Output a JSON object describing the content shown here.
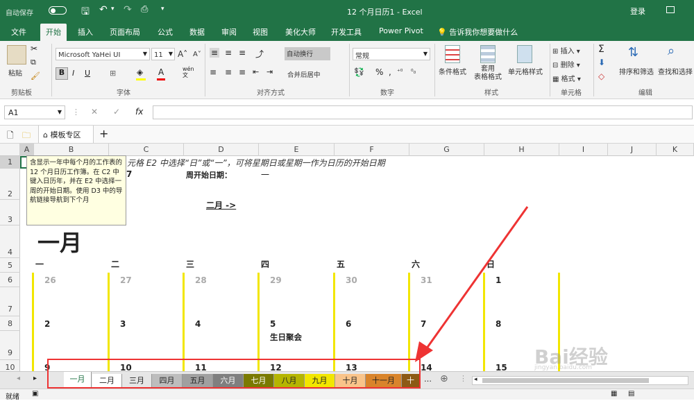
{
  "titlebar": {
    "autosave": "自动保存",
    "filename": "12 个月日历1",
    "app": "Excel",
    "login": "登录"
  },
  "tabs": [
    "文件",
    "开始",
    "插入",
    "页面布局",
    "公式",
    "数据",
    "审阅",
    "视图",
    "美化大师",
    "开发工具",
    "Power Pivot"
  ],
  "tellme": "告诉我你想要做什么",
  "ribbon": {
    "paste": "粘贴",
    "clipboard": "剪贴板",
    "font_name": "Microsoft YaHei UI",
    "font_size": "11",
    "font_group": "字体",
    "wrap": "自动换行",
    "merge": "合并后居中",
    "align_group": "对齐方式",
    "number_format": "常规",
    "number_group": "数字",
    "cond_format": "条件格式",
    "table_format": "套用\n表格格式",
    "cell_style": "单元格样式",
    "style_group": "样式",
    "insert": "插入",
    "delete": "删除",
    "format": "格式",
    "cells_group": "单元格",
    "sort_filter": "排序和筛选",
    "find_select": "查找和选择",
    "edit_group": "编辑",
    "bold": "B",
    "italic": "I",
    "underline": "U",
    "wen": "wén\n文",
    "sigma": "Σ"
  },
  "formula": {
    "namebox": "A1",
    "fx": "fx"
  },
  "templatebar": {
    "label": "模板专区",
    "add": "+"
  },
  "columns": [
    "A",
    "B",
    "C",
    "D",
    "E",
    "F",
    "G",
    "H",
    "I",
    "J",
    "K"
  ],
  "rows": [
    "1",
    "2",
    "3",
    "4",
    "5",
    "6",
    "7",
    "8",
    "9",
    "10"
  ],
  "sheet": {
    "instruction": "元格 E2 中选择“日”或“一”，可将星期日或星期一作为日历的开始日期",
    "row2_number": "7",
    "week_start_label": "周开始日期：",
    "week_start_value": "一",
    "next_month_link": "二月 ->",
    "month_title": "一月",
    "weekdays": [
      "一",
      "二",
      "三",
      "四",
      "五",
      "六",
      "日"
    ],
    "week1": [
      "26",
      "27",
      "28",
      "29",
      "30",
      "31",
      "1"
    ],
    "week2": [
      "2",
      "3",
      "4",
      "5",
      "6",
      "7",
      "8"
    ],
    "event": "生日聚会",
    "week3": [
      "9",
      "10",
      "11",
      "12",
      "13",
      "14",
      "15"
    ]
  },
  "tooltip": "含显示一年中每个月的工作表的 12 个月日历工作簿。在 C2 中键入日历年，并在 E2 中选择一周的开始日期。使用 D3 中的导航链接导航到下个月",
  "sheettabs": [
    {
      "label": "一月",
      "color": "#ffffff"
    },
    {
      "label": "二月",
      "color": "#ffffff"
    },
    {
      "label": "三月",
      "color": "#e6e6e6"
    },
    {
      "label": "四月",
      "color": "#bdbdbd"
    },
    {
      "label": "五月",
      "color": "#a0a0a0"
    },
    {
      "label": "六月",
      "color": "#7f7f7f"
    },
    {
      "label": "七月",
      "color": "#7a7a00"
    },
    {
      "label": "八月",
      "color": "#b5b500"
    },
    {
      "label": "九月",
      "color": "#f2e600"
    },
    {
      "label": "十月",
      "color": "#f9c48a"
    },
    {
      "label": "十一月",
      "color": "#d9842b"
    },
    {
      "label": "十",
      "color": "#8c5a14"
    }
  ],
  "status": {
    "ready": "就绪"
  },
  "watermark": {
    "brand": "Bai经验",
    "url": "jingyan.baidu.com"
  }
}
